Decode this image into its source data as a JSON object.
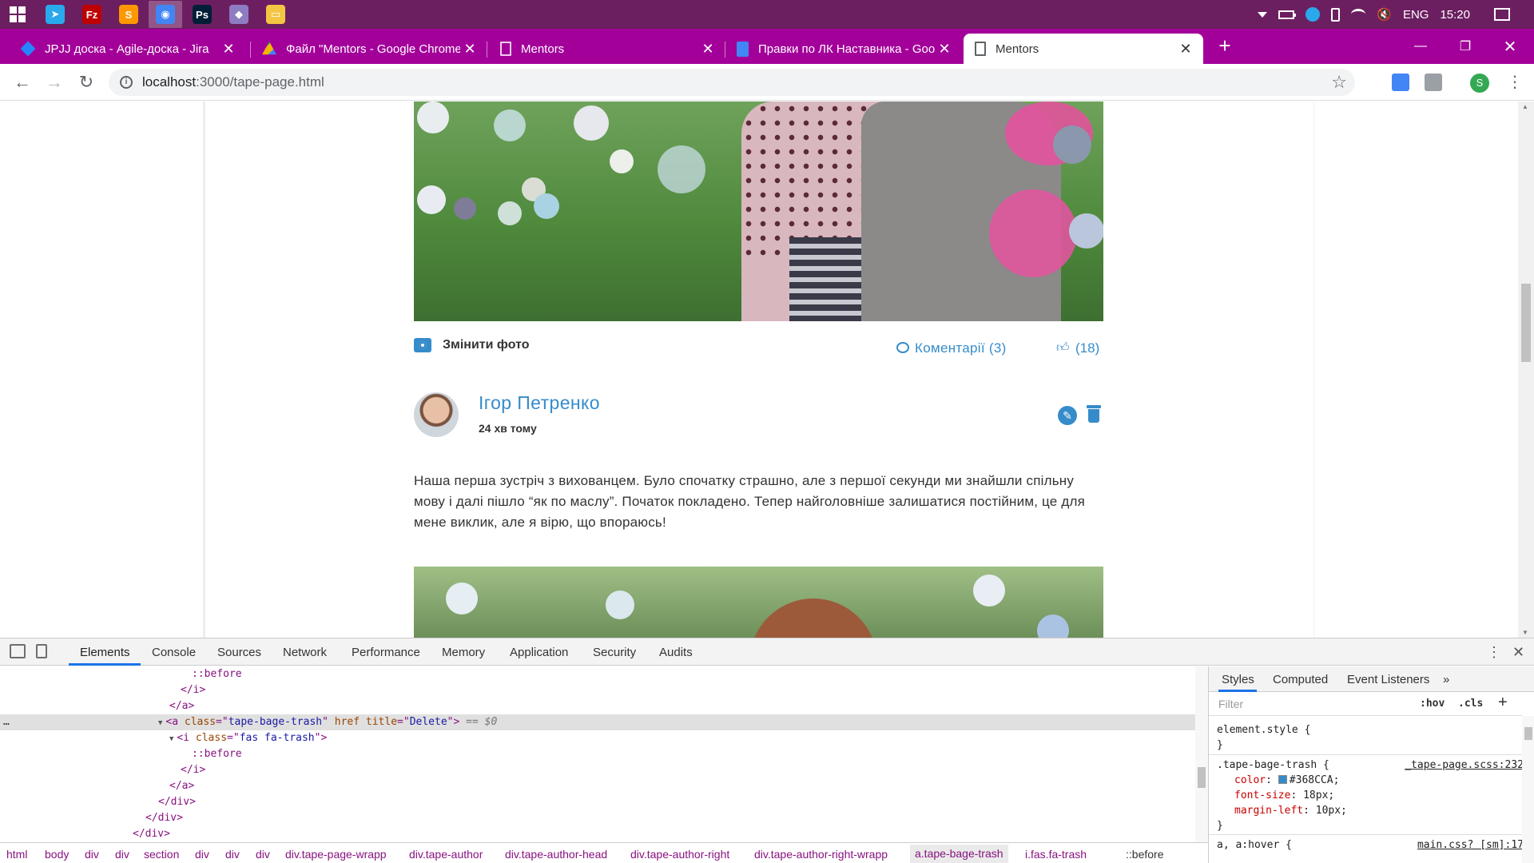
{
  "taskbar": {
    "apps": [
      {
        "name": "telegram-app",
        "color": "#29a9eb",
        "glyph": "➤"
      },
      {
        "name": "filezilla-app",
        "color": "#bf0000",
        "glyph": "Fz"
      },
      {
        "name": "sublime-app",
        "color": "#ff9800",
        "glyph": "S"
      },
      {
        "name": "chrome-app",
        "color": "#4285f4",
        "glyph": "◉"
      },
      {
        "name": "photoshop-app",
        "color": "#001e36",
        "glyph": "Ps"
      },
      {
        "name": "git-app",
        "color": "#8e7cc3",
        "glyph": "◆"
      },
      {
        "name": "explorer-app",
        "color": "#f4c542",
        "glyph": "▭"
      }
    ],
    "lang": "ENG",
    "clock": "15:20"
  },
  "tabs": [
    {
      "title": "JPJJ доска - Agile-доска - Jira",
      "icon": "jira-icon",
      "color": "#2684ff"
    },
    {
      "title": "Файл \"Mentors - Google Chrome",
      "icon": "drive-icon",
      "color": "#f4b400"
    },
    {
      "title": "Mentors",
      "icon": "page-icon",
      "color": "#ffffff"
    },
    {
      "title": "Правки по ЛК Наставника - Goo",
      "icon": "docs-icon",
      "color": "#4285f4"
    },
    {
      "title": "Mentors",
      "icon": "page-icon",
      "color": "#5f6368"
    }
  ],
  "address": {
    "host": "localhost",
    "path": ":3000/tape-page.html"
  },
  "page": {
    "change_photo": "Змінити фото",
    "comments": "Коментарії (3)",
    "likes": "(18)",
    "author_name": "Ігор Петренко",
    "post_time": "24 хв тому",
    "post_text": "Наша перша зустріч з вихованцем. Було спочатку страшно, але з першої секунди ми знайшли спільну мову і далі пішло “як по маслу”. Початок покладено. Тепер найголовніше залишатися постійним, це для мене виклик, але я вірю, що впораюсь!",
    "accent": "#368cca"
  },
  "devtools": {
    "tabs": [
      "Elements",
      "Console",
      "Sources",
      "Network",
      "Performance",
      "Memory",
      "Application",
      "Security",
      "Audits"
    ],
    "dom_lines": [
      {
        "indent": 240,
        "parts": [
          [
            "t-pseudo",
            "::before"
          ]
        ]
      },
      {
        "indent": 226,
        "parts": [
          [
            "t-tag",
            "</i>"
          ]
        ]
      },
      {
        "indent": 212,
        "parts": [
          [
            "t-tag",
            "</a>"
          ]
        ]
      },
      {
        "indent": 212,
        "selected": true,
        "parts": [
          [
            "t-tag",
            "<a "
          ],
          [
            "t-attr",
            "class"
          ],
          [
            "t-tag",
            "=\""
          ],
          [
            "t-val",
            "tape-bage-trash"
          ],
          [
            "t-tag",
            "\" "
          ],
          [
            "t-attr",
            "href"
          ],
          [
            "t-tag",
            " "
          ],
          [
            "t-attr",
            "title"
          ],
          [
            "t-tag",
            "=\""
          ],
          [
            "t-val",
            "Delete"
          ],
          [
            "t-tag",
            "\">"
          ],
          [
            "t-eq",
            " == $0"
          ]
        ]
      },
      {
        "indent": 226,
        "parts": [
          [
            "t-tag",
            "<i "
          ],
          [
            "t-attr",
            "class"
          ],
          [
            "t-tag",
            "=\""
          ],
          [
            "t-val",
            "fas fa-trash"
          ],
          [
            "t-tag",
            "\">"
          ]
        ]
      },
      {
        "indent": 240,
        "parts": [
          [
            "t-pseudo",
            "::before"
          ]
        ]
      },
      {
        "indent": 226,
        "parts": [
          [
            "t-tag",
            "</i>"
          ]
        ]
      },
      {
        "indent": 212,
        "parts": [
          [
            "t-tag",
            "</a>"
          ]
        ]
      },
      {
        "indent": 198,
        "parts": [
          [
            "t-tag",
            "</div>"
          ]
        ]
      },
      {
        "indent": 182,
        "parts": [
          [
            "t-tag",
            "</div>"
          ]
        ]
      },
      {
        "indent": 166,
        "parts": [
          [
            "t-tag",
            "</div>"
          ]
        ]
      }
    ],
    "breadcrumbs": [
      "html",
      "body",
      "div",
      "div",
      "section",
      "div",
      "div",
      "div",
      "div.tape-page-wrapp",
      "div.tape-author",
      "div.tape-author-head",
      "div.tape-author-right",
      "div.tape-author-right-wrapp",
      "a.tape-bage-trash",
      "i.fas.fa-trash",
      "::before"
    ],
    "styles_tabs": [
      "Styles",
      "Computed",
      "Event Listeners"
    ],
    "filter_placeholder": "Filter",
    "hov": ":hov",
    "cls": ".cls",
    "element_style": "element.style {",
    "rule_selector": ".tape-bage-trash {",
    "rule_source": "_tape-page.scss:232",
    "rule_props": [
      {
        "prop": "color",
        "val": "#368CCA;"
      },
      {
        "prop": "font-size",
        "val": "18px;"
      },
      {
        "prop": "margin-left",
        "val": "10px;"
      }
    ],
    "next_selector": "a, a:hover {",
    "next_source": "main.css? [sm]:17"
  }
}
